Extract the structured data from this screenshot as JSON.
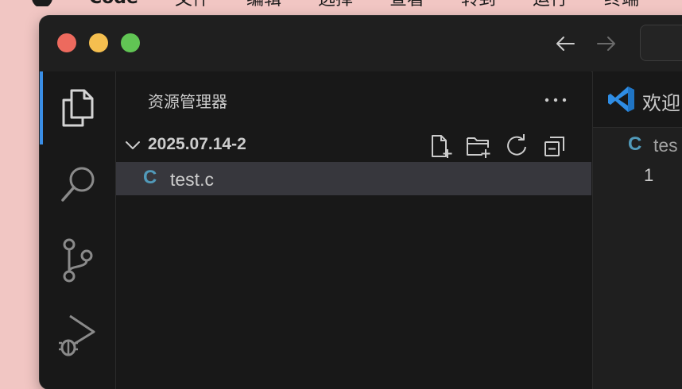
{
  "menubar": {
    "app_name": "Code",
    "items": [
      "文件",
      "编辑",
      "选择",
      "查看",
      "转到",
      "运行",
      "终端"
    ]
  },
  "sidebar": {
    "title": "资源管理器",
    "folder_name": "2025.07.14-2",
    "files": [
      {
        "badge": "C",
        "name": "test.c"
      }
    ]
  },
  "editor": {
    "tab_label": "欢迎",
    "breadcrumb_badge": "C",
    "breadcrumb_file": "tes",
    "line_number": "1"
  },
  "colors": {
    "accent": "#3a8ee6",
    "c_file_icon": "#519aba",
    "selected_row": "#37373d"
  },
  "icons": {
    "activity": [
      "files-icon",
      "search-icon",
      "source-control-icon",
      "run-debug-icon"
    ],
    "toolbar": [
      "new-file-icon",
      "new-folder-icon",
      "refresh-icon",
      "collapse-all-icon"
    ]
  }
}
